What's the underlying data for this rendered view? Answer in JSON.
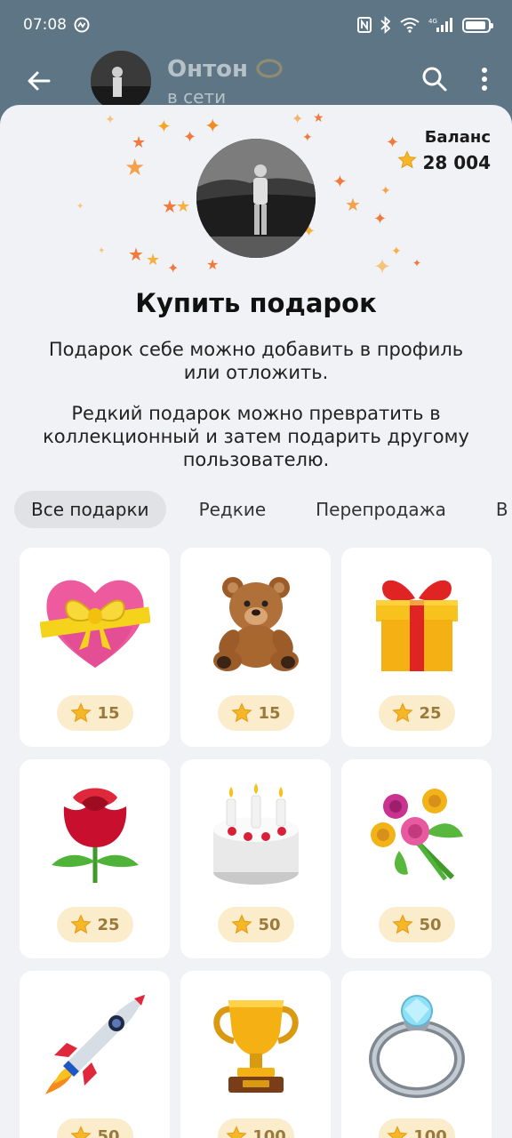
{
  "status_bar": {
    "time": "07:08",
    "network": "4G"
  },
  "chat": {
    "name": "Онтон",
    "status": "в сети"
  },
  "sheet": {
    "balance_label": "Баланс",
    "balance_value": "28 004",
    "title": "Купить подарок",
    "description_1": "Подарок себе можно добавить в профиль или отложить.",
    "description_2": "Редкий подарок можно превратить в коллекционный и затем подарить другому пользователю."
  },
  "tabs": [
    {
      "label": "Все подарки",
      "active": true
    },
    {
      "label": "Редкие",
      "active": false
    },
    {
      "label": "Перепродажа",
      "active": false
    },
    {
      "label": "В наличии",
      "active": false
    }
  ],
  "gifts": [
    {
      "name": "heart-with-ribbon",
      "price": "15"
    },
    {
      "name": "teddy-bear",
      "price": "15"
    },
    {
      "name": "gift-box",
      "price": "25"
    },
    {
      "name": "rose",
      "price": "25"
    },
    {
      "name": "birthday-cake",
      "price": "50"
    },
    {
      "name": "bouquet",
      "price": "50"
    },
    {
      "name": "rocket",
      "price": "50"
    },
    {
      "name": "trophy",
      "price": "100"
    },
    {
      "name": "diamond-ring",
      "price": "100"
    }
  ],
  "colors": {
    "header_bg": "#5d7585",
    "sheet_bg": "#f1f2f6",
    "price_pill_bg": "#fbeccb",
    "star": "#f5b728"
  }
}
